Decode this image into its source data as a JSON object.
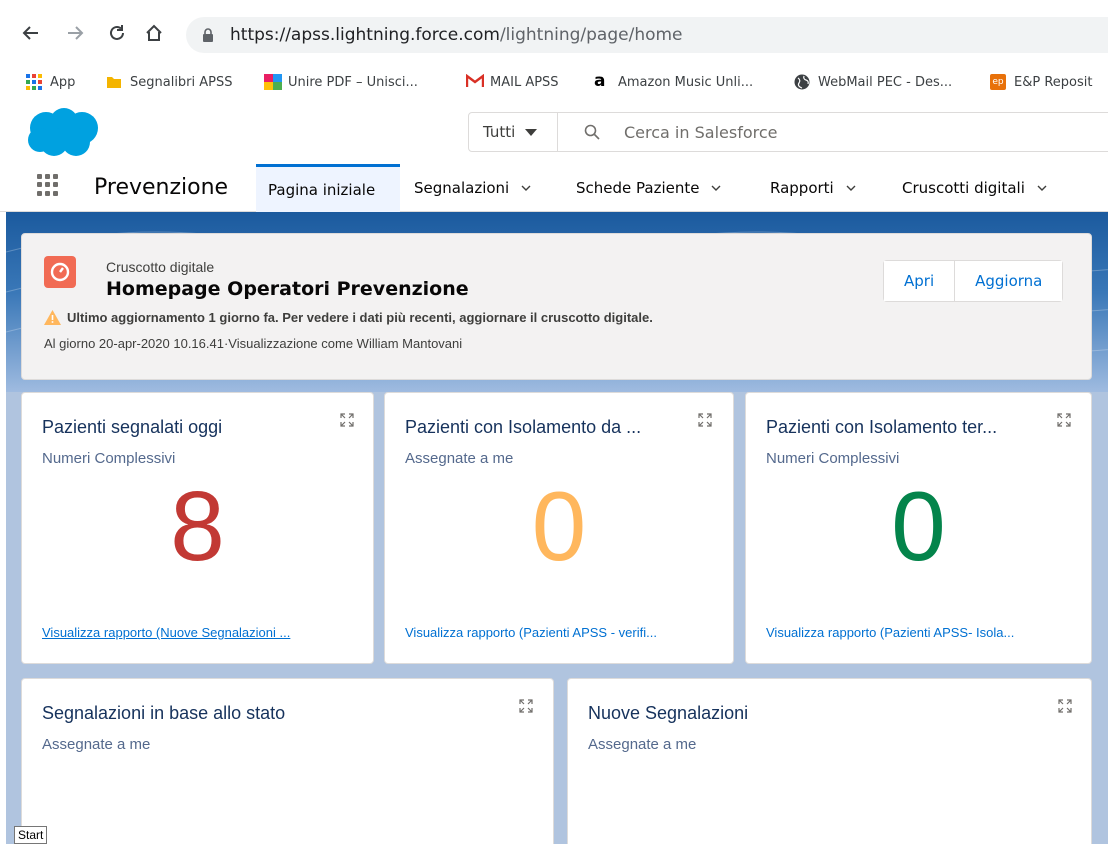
{
  "browser": {
    "url_host": "https://apss.lightning.force.com",
    "url_path": "/lightning/page/home",
    "bookmarks": [
      {
        "label": "App",
        "icon": "apps-grid-icon",
        "color": "#1a73e8"
      },
      {
        "label": "Segnalibri APSS",
        "icon": "folder-icon",
        "color": "#f4b400"
      },
      {
        "label": "Unire PDF – Unisci...",
        "icon": "pdf-tiles-icon",
        "color": "#e91e63"
      },
      {
        "label": "MAIL APSS",
        "icon": "gmail-icon",
        "color": "#d93025"
      },
      {
        "label": "Amazon Music Unli...",
        "icon": "amazon-icon",
        "color": "#000000"
      },
      {
        "label": "WebMail PEC - Des...",
        "icon": "globe-icon",
        "color": "#3c4043"
      },
      {
        "label": "E&P Reposit",
        "icon": "ep-icon",
        "color": "#e8710a"
      }
    ]
  },
  "header": {
    "search_scope": "Tutti",
    "search_placeholder": "Cerca in Salesforce",
    "app_name": "Prevenzione",
    "tabs": [
      {
        "label": "Pagina iniziale",
        "active": true
      },
      {
        "label": "Segnalazioni",
        "active": false
      },
      {
        "label": "Schede Paziente",
        "active": false
      },
      {
        "label": "Rapporti",
        "active": false
      },
      {
        "label": "Cruscotti digitali",
        "active": false
      }
    ]
  },
  "dashboard": {
    "type_label": "Cruscotto digitale",
    "title": "Homepage Operatori Prevenzione",
    "warning": "Ultimo aggiornamento 1 giorno fa. Per vedere i dati più recenti, aggiornare il cruscotto digitale.",
    "info": "Al giorno 20-apr-2020 10.16.41·Visualizzazione come William Mantovani",
    "open_label": "Apri",
    "refresh_label": "Aggiorna"
  },
  "cards": [
    {
      "title": "Pazienti segnalati oggi",
      "subtitle": "Numeri Complessivi",
      "value": "8",
      "color": "#c23934",
      "link": "Visualizza rapporto (Nuove Segnalazioni ..."
    },
    {
      "title": "Pazienti con Isolamento da ...",
      "subtitle": "Assegnate a me",
      "value": "0",
      "color": "#ffb75d",
      "link": "Visualizza rapporto (Pazienti APSS - verifi..."
    },
    {
      "title": "Pazienti con Isolamento ter...",
      "subtitle": "Numeri Complessivi",
      "value": "0",
      "color": "#04844b",
      "link": "Visualizza rapporto (Pazienti APSS- Isola..."
    },
    {
      "title": "Segnalazioni in base allo stato",
      "subtitle": "Assegnate a me"
    },
    {
      "title": "Nuove Segnalazioni",
      "subtitle": "Assegnate a me"
    }
  ],
  "tooltip": "Start"
}
